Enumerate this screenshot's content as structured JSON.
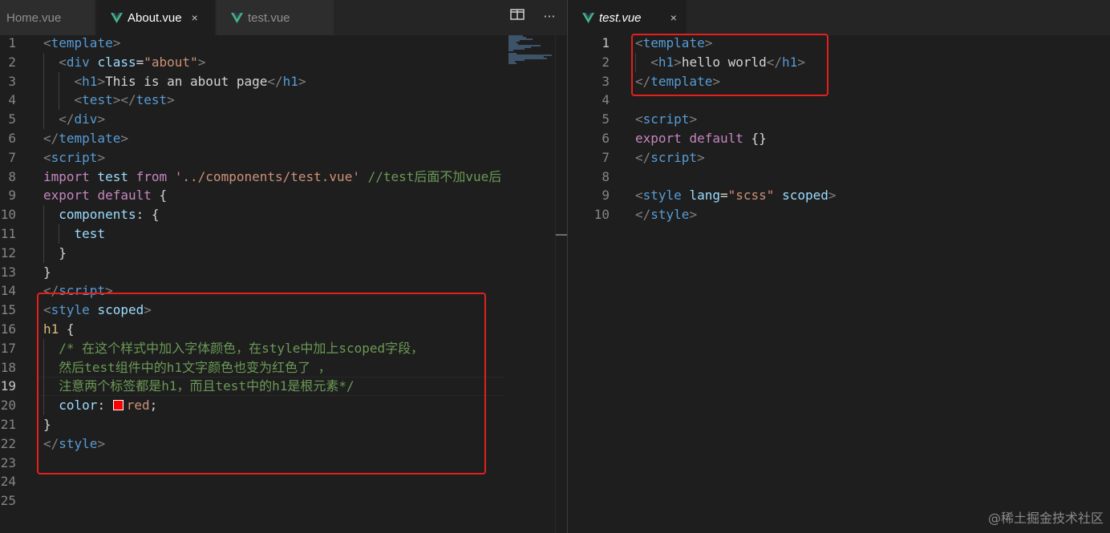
{
  "left_editor": {
    "tabs": [
      {
        "label": "Home.vue",
        "active": false
      },
      {
        "label": "About.vue",
        "active": true,
        "close": "×"
      },
      {
        "label": "test.vue",
        "active": false
      }
    ],
    "actions": {
      "split_icon": "split-editor-icon",
      "more": "···"
    },
    "current_line": 19,
    "lines": [
      {
        "n": "1",
        "t": [
          [
            "<",
            "pu"
          ],
          [
            "template",
            "tg"
          ],
          [
            ">",
            "pu"
          ]
        ]
      },
      {
        "n": "2",
        "t": [
          [
            "  "
          ],
          [
            "<",
            "pu"
          ],
          [
            "div",
            "tg"
          ],
          [
            " "
          ],
          [
            "class",
            "at"
          ],
          [
            "=",
            "tx"
          ],
          [
            "\"about\"",
            "st"
          ],
          [
            ">",
            "pu"
          ]
        ]
      },
      {
        "n": "3",
        "t": [
          [
            "    "
          ],
          [
            "<",
            "pu"
          ],
          [
            "h1",
            "tg"
          ],
          [
            ">",
            "pu"
          ],
          [
            "This is an about page",
            "tx"
          ],
          [
            "</",
            "pu"
          ],
          [
            "h1",
            "tg"
          ],
          [
            ">",
            "pu"
          ]
        ]
      },
      {
        "n": "4",
        "t": [
          [
            "    "
          ],
          [
            "<",
            "pu"
          ],
          [
            "test",
            "tg"
          ],
          [
            "></",
            "pu"
          ],
          [
            "test",
            "tg"
          ],
          [
            ">",
            "pu"
          ]
        ]
      },
      {
        "n": "5",
        "t": [
          [
            "  "
          ],
          [
            "</",
            "pu"
          ],
          [
            "div",
            "tg"
          ],
          [
            ">",
            "pu"
          ]
        ]
      },
      {
        "n": "6",
        "t": [
          [
            "</",
            "pu"
          ],
          [
            "template",
            "tg"
          ],
          [
            ">",
            "pu"
          ]
        ]
      },
      {
        "n": "7",
        "t": [
          [
            "<",
            "pu"
          ],
          [
            "script",
            "tg"
          ],
          [
            ">",
            "pu"
          ]
        ]
      },
      {
        "n": "8",
        "t": [
          [
            "import",
            "kw"
          ],
          [
            " test ",
            "at"
          ],
          [
            "from",
            "kw"
          ],
          [
            " "
          ],
          [
            "'../components/test.vue'",
            "st"
          ],
          [
            " "
          ],
          [
            "//test后面不加vue后",
            "cm"
          ]
        ]
      },
      {
        "n": "9",
        "t": [
          [
            "export",
            "kw"
          ],
          [
            " "
          ],
          [
            "default",
            "kw"
          ],
          [
            " {",
            "tx"
          ]
        ]
      },
      {
        "n": "10",
        "t": [
          [
            "  "
          ],
          [
            "components",
            "at"
          ],
          [
            ": {",
            "tx"
          ]
        ]
      },
      {
        "n": "11",
        "t": [
          [
            "    "
          ],
          [
            "test",
            "at"
          ]
        ]
      },
      {
        "n": "12",
        "t": [
          [
            "  "
          ],
          [
            "}",
            "tx"
          ]
        ]
      },
      {
        "n": "13",
        "t": [
          [
            "}",
            "tx"
          ]
        ]
      },
      {
        "n": "14",
        "t": [
          [
            "</",
            "pu"
          ],
          [
            "script",
            "tg"
          ],
          [
            ">",
            "pu"
          ]
        ]
      },
      {
        "n": "15",
        "t": [
          [
            "<",
            "pu"
          ],
          [
            "style",
            "tg"
          ],
          [
            " "
          ],
          [
            "scoped",
            "at"
          ],
          [
            ">",
            "pu"
          ]
        ]
      },
      {
        "n": "16",
        "t": [
          [
            "h1",
            "sel"
          ],
          [
            " {",
            "tx"
          ]
        ]
      },
      {
        "n": "17",
        "t": [
          [
            "  "
          ],
          [
            "/* 在这个样式中加入字体颜色，在style中加上scoped字段，",
            "cm"
          ]
        ]
      },
      {
        "n": "18",
        "t": [
          [
            "  "
          ],
          [
            "然后test组件中的h1文字颜色也变为红色了 ，",
            "cm"
          ]
        ]
      },
      {
        "n": "19",
        "t": [
          [
            "  "
          ],
          [
            "注意两个标签都是h1，而且test中的h1是根元素*/",
            "cm"
          ]
        ]
      },
      {
        "n": "20",
        "t": [
          [
            "  "
          ],
          [
            "color",
            "at"
          ],
          [
            ": ",
            "tx"
          ],
          [
            "SWATCH"
          ],
          [
            "red",
            "st"
          ],
          [
            ";",
            "tx"
          ]
        ]
      },
      {
        "n": "21",
        "t": [
          [
            "}",
            "tx"
          ]
        ]
      },
      {
        "n": "22",
        "t": [
          [
            "</",
            "pu"
          ],
          [
            "style",
            "tg"
          ],
          [
            ">",
            "pu"
          ]
        ]
      },
      {
        "n": "23",
        "t": []
      },
      {
        "n": "24",
        "t": []
      },
      {
        "n": "25",
        "t": []
      }
    ]
  },
  "right_editor": {
    "tabs": [
      {
        "label": "test.vue",
        "active": true,
        "italic": true,
        "close": "×"
      }
    ],
    "current_line": 1,
    "lines": [
      {
        "n": "1",
        "t": [
          [
            "<",
            "pu"
          ],
          [
            "template",
            "tg"
          ],
          [
            ">",
            "pu"
          ]
        ]
      },
      {
        "n": "2",
        "t": [
          [
            "  "
          ],
          [
            "<",
            "pu"
          ],
          [
            "h1",
            "tg"
          ],
          [
            ">",
            "pu"
          ],
          [
            "hello world",
            "tx"
          ],
          [
            "</",
            "pu"
          ],
          [
            "h1",
            "tg"
          ],
          [
            ">",
            "pu"
          ]
        ]
      },
      {
        "n": "3",
        "t": [
          [
            "</",
            "pu"
          ],
          [
            "template",
            "tg"
          ],
          [
            ">",
            "pu"
          ]
        ]
      },
      {
        "n": "4",
        "t": []
      },
      {
        "n": "5",
        "t": [
          [
            "<",
            "pu"
          ],
          [
            "script",
            "tg"
          ],
          [
            ">",
            "pu"
          ]
        ]
      },
      {
        "n": "6",
        "t": [
          [
            "export",
            "kw"
          ],
          [
            " "
          ],
          [
            "default",
            "kw"
          ],
          [
            " {}",
            "tx"
          ]
        ]
      },
      {
        "n": "7",
        "t": [
          [
            "</",
            "pu"
          ],
          [
            "script",
            "tg"
          ],
          [
            ">",
            "pu"
          ]
        ]
      },
      {
        "n": "8",
        "t": []
      },
      {
        "n": "9",
        "t": [
          [
            "<",
            "pu"
          ],
          [
            "style",
            "tg"
          ],
          [
            " "
          ],
          [
            "lang",
            "at"
          ],
          [
            "=",
            "tx"
          ],
          [
            "\"scss\"",
            "st"
          ],
          [
            " "
          ],
          [
            "scoped",
            "at"
          ],
          [
            ">",
            "pu"
          ]
        ]
      },
      {
        "n": "10",
        "t": [
          [
            "</",
            "pu"
          ],
          [
            "style",
            "tg"
          ],
          [
            ">",
            "pu"
          ]
        ]
      }
    ]
  },
  "colors": {
    "highlight": "#e3201b",
    "vue_green": "#41b883",
    "swatch": "#ff0000"
  },
  "watermark": "@稀土掘金技术社区"
}
